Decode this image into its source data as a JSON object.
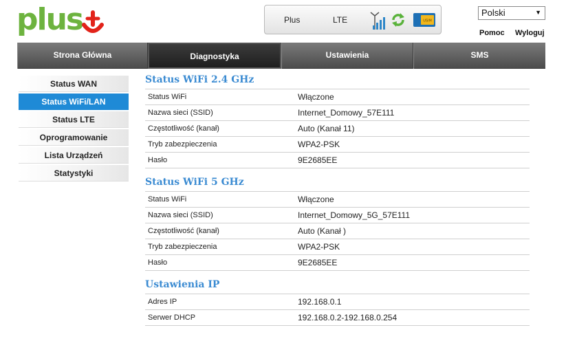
{
  "brand": {
    "logo_text": "plus",
    "logo_color": "#6db33f",
    "mark_color": "#e2231a"
  },
  "status_bar": {
    "operator": "Plus",
    "network_type": "LTE",
    "signal_icon": "signal-bars-icon",
    "refresh_icon": "refresh-icon",
    "sim_label": "USIM",
    "signal_level": 4,
    "signal_max": 4
  },
  "top_links": {
    "language": "Polski",
    "help": "Pomoc",
    "logout": "Wyloguj"
  },
  "nav": {
    "tabs": [
      {
        "label": "Strona Główna",
        "active": false
      },
      {
        "label": "Diagnostyka",
        "active": true
      },
      {
        "label": "Ustawienia",
        "active": false
      },
      {
        "label": "SMS",
        "active": false
      }
    ]
  },
  "sidebar": {
    "items": [
      {
        "label": "Status WAN",
        "active": false
      },
      {
        "label": "Status WiFi/LAN",
        "active": true
      },
      {
        "label": "Status LTE",
        "active": false
      },
      {
        "label": "Oprogramowanie",
        "active": false
      },
      {
        "label": "Lista Urządzeń",
        "active": false
      },
      {
        "label": "Statystyki",
        "active": false
      }
    ]
  },
  "sections": [
    {
      "title": "Status WiFi 2.4 GHz",
      "rows": [
        {
          "label": "Status WiFi",
          "value": "Włączone"
        },
        {
          "label": "Nazwa sieci (SSID)",
          "value": "Internet_Domowy_57E111"
        },
        {
          "label": "Częstotliwość (kanał)",
          "value": "Auto (Kanał 11)"
        },
        {
          "label": "Tryb zabezpieczenia",
          "value": "WPA2-PSK"
        },
        {
          "label": "Hasło",
          "value": "9E2685EE"
        }
      ]
    },
    {
      "title": "Status WiFi 5 GHz",
      "rows": [
        {
          "label": "Status WiFi",
          "value": "Włączone"
        },
        {
          "label": "Nazwa sieci (SSID)",
          "value": "Internet_Domowy_5G_57E111"
        },
        {
          "label": "Częstotliwość (kanał)",
          "value": "Auto (Kanał )"
        },
        {
          "label": "Tryb zabezpieczenia",
          "value": "WPA2-PSK"
        },
        {
          "label": "Hasło",
          "value": "9E2685EE"
        }
      ]
    },
    {
      "title": "Ustawienia IP",
      "rows": [
        {
          "label": "Adres IP",
          "value": "192.168.0.1"
        },
        {
          "label": "Serwer DHCP",
          "value": "192.168.0.2-192.168.0.254"
        }
      ]
    }
  ],
  "colors": {
    "accent_blue": "#3b8bd2",
    "sidebar_active": "#1f8ad6",
    "nav_dark": "#4c4c4c"
  }
}
